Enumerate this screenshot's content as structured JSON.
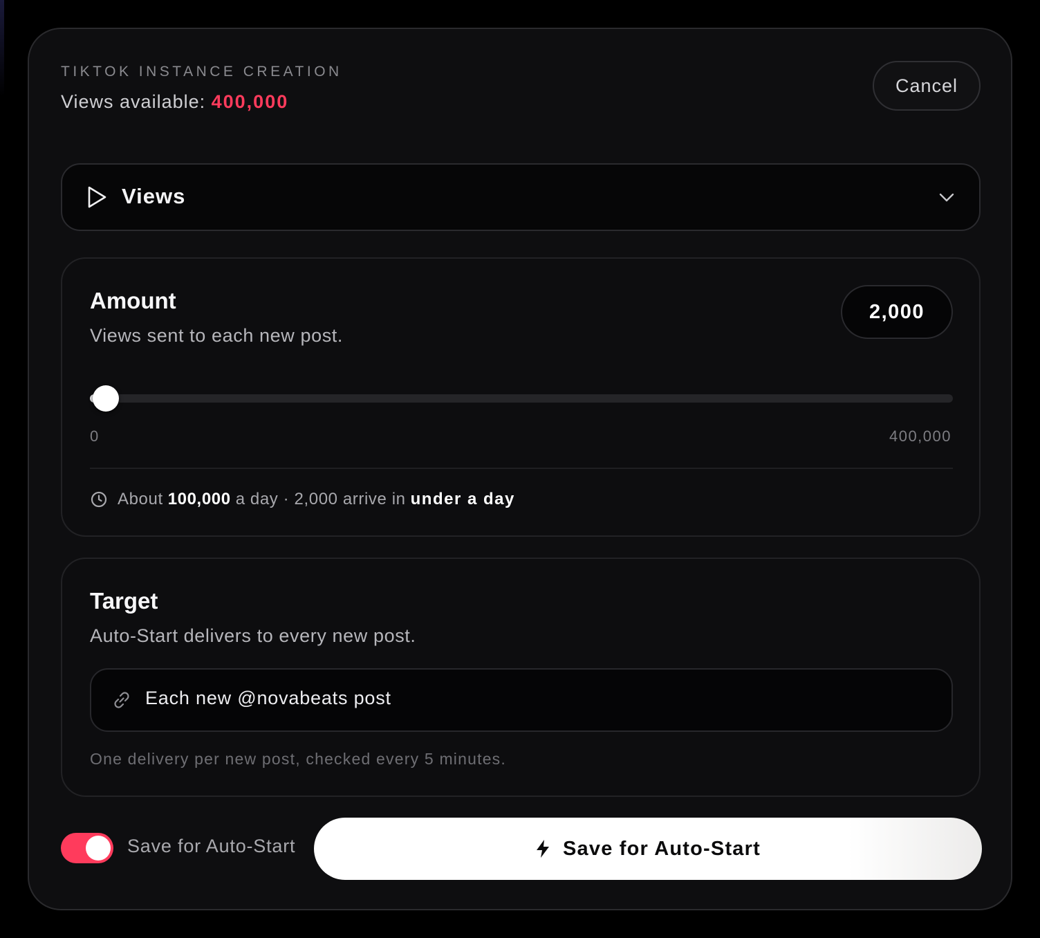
{
  "header": {
    "eyebrow": "TIKTOK INSTANCE CREATION",
    "available_label": "Views available: ",
    "available_value": "400,000",
    "cancel_label": "Cancel"
  },
  "service": {
    "icon": "play-icon",
    "label": "Views",
    "chevron": "chevron-down-icon"
  },
  "amount": {
    "title": "Amount",
    "subtitle": "Views sent to each new post.",
    "value": "2,000",
    "slider": {
      "min_label": "0",
      "max_label": "400,000",
      "min": 0,
      "max": 400000,
      "current": 2000
    },
    "eta": {
      "icon": "clock-icon",
      "prefix": "About",
      "rate": "100,000",
      "middle": "a day · 2,000 arrive in",
      "duration": "under a day"
    }
  },
  "target": {
    "title": "Target",
    "subtitle": "Auto-Start delivers to every new post.",
    "field_icon": "link-icon",
    "field_value": "Each new @novabeats post",
    "note": "One delivery per new post, checked every 5 minutes."
  },
  "footer": {
    "toggle_on": true,
    "toggle_label": "Save for Auto-Start",
    "submit_icon": "bolt-icon",
    "submit_label": "Save for Auto-Start"
  },
  "colors": {
    "accent": "#ff3b5c",
    "background": "#000000",
    "panel": "#0e0e10"
  }
}
